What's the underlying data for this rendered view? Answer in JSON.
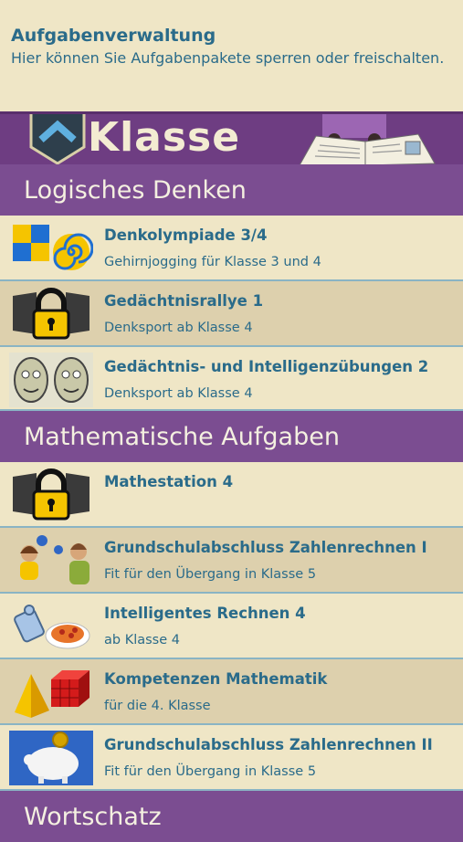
{
  "header": {
    "title": "Aufgabenverwaltung",
    "description": "Hier können Sie Aufgabenpakete sperren oder freischalten."
  },
  "banner": {
    "title": "Klasse"
  },
  "sections": [
    {
      "title": "Logisches Denken",
      "items": [
        {
          "name": "Denkolympiade 3/4",
          "subtitle": "Gehirnjogging für Klasse 3 und 4",
          "icon": "puzzle-spiral-icon",
          "locked": false
        },
        {
          "name": "Gedächtnisrallye 1",
          "subtitle": "Denksport ab Klasse 4",
          "icon": "lock-icon",
          "locked": true
        },
        {
          "name": "Gedächtnis- und Intelligenzübungen 2",
          "subtitle": "Denksport ab Klasse 4",
          "icon": "faces-icon",
          "locked": false
        }
      ]
    },
    {
      "title": "Mathematische Aufgaben",
      "items": [
        {
          "name": "Mathestation 4",
          "subtitle": "",
          "icon": "lock-icon",
          "locked": true
        },
        {
          "name": "Grundschulabschluss Zahlenrechnen I",
          "subtitle": "Fit für den Übergang in Klasse 5",
          "icon": "kids-icon",
          "locked": false
        },
        {
          "name": "Intelligentes Rechnen 4",
          "subtitle": "ab Klasse 4",
          "icon": "robot-pizza-icon",
          "locked": false
        },
        {
          "name": "Kompetenzen Mathematik",
          "subtitle": "für die 4. Klasse",
          "icon": "pyramid-cube-icon",
          "locked": false
        },
        {
          "name": "Grundschulabschluss Zahlenrechnen II",
          "subtitle": "Fit für den Übergang in Klasse 5",
          "icon": "piggy-bank-icon",
          "locked": false
        }
      ]
    },
    {
      "title": "Wortschatz",
      "items": []
    }
  ],
  "colors": {
    "background": "#efe6c6",
    "row_alt": "#ddd0ad",
    "section": "#7b4d91",
    "text": "#2a6b8a"
  }
}
